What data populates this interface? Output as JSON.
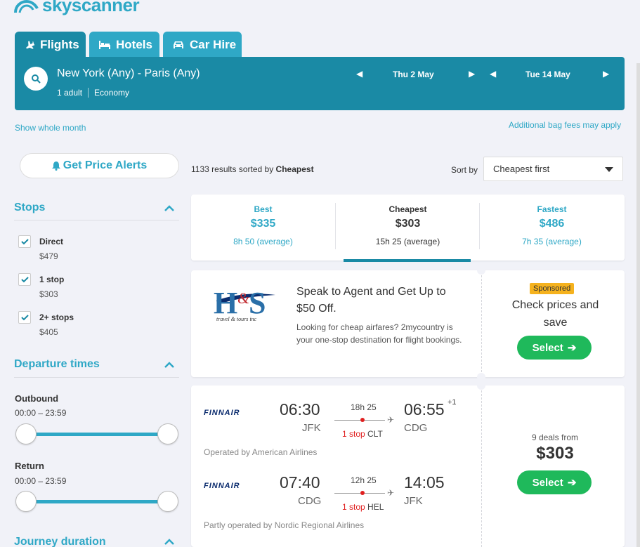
{
  "logo": {
    "text": "skyscanner"
  },
  "tabs": [
    {
      "label": "Flights",
      "icon": "plane-icon",
      "active": true
    },
    {
      "label": "Hotels",
      "icon": "bed-icon",
      "active": false
    },
    {
      "label": "Car Hire",
      "icon": "car-icon",
      "active": false
    }
  ],
  "search": {
    "route": "New York (Any) - Paris (Any)",
    "adults": "1 adult",
    "cabin": "Economy",
    "depart_date": "Thu 2 May",
    "return_date": "Tue 14 May"
  },
  "links": {
    "show_month": "Show whole month",
    "bag_fees": "Additional bag fees may apply"
  },
  "sidebar": {
    "price_alerts": "Get Price Alerts",
    "stops_title": "Stops",
    "stops": [
      {
        "label": "Direct",
        "price": "$479",
        "checked": true
      },
      {
        "label": "1 stop",
        "price": "$303",
        "checked": true
      },
      {
        "label": "2+ stops",
        "price": "$405",
        "checked": true
      }
    ],
    "departure_title": "Departure times",
    "outbound_label": "Outbound",
    "outbound_range": "00:00 – 23:59",
    "return_label": "Return",
    "return_range": "00:00 – 23:59",
    "journey_title": "Journey duration"
  },
  "results": {
    "count": "1133",
    "sorted_by_text": "results sorted by",
    "sorted_by_value": "Cheapest",
    "sort_by_label": "Sort by",
    "sort_selected": "Cheapest first"
  },
  "sort_tabs": [
    {
      "label": "Best",
      "price": "$335",
      "duration": "8h 50 (average)",
      "active": false
    },
    {
      "label": "Cheapest",
      "price": "$303",
      "duration": "15h 25 (average)",
      "active": true
    },
    {
      "label": "Fastest",
      "price": "$486",
      "duration": "7h 35 (average)",
      "active": false
    }
  ],
  "ad": {
    "logo_text": "H&S",
    "logo_sub": "travel & tours inc",
    "title": "Speak to Agent and Get Up to $50 Off.",
    "description": "Looking for cheap airfares? 2mycountry is your one-stop destination for flight bookings.",
    "sponsored": "Sponsored",
    "cta_text": "Check prices and save",
    "select": "Select"
  },
  "flight": {
    "outbound": {
      "airline": "FINNAIR",
      "depart_time": "06:30",
      "depart_code": "JFK",
      "duration": "18h 25",
      "stops_count": "1 stop",
      "stop_airport": "CLT",
      "arrive_time": "06:55",
      "arrive_offset": "+1",
      "arrive_code": "CDG",
      "operated": "Operated by American Airlines"
    },
    "inbound": {
      "airline": "FINNAIR",
      "depart_time": "07:40",
      "depart_code": "CDG",
      "duration": "12h 25",
      "stops_count": "1 stop",
      "stop_airport": "HEL",
      "arrive_time": "14:05",
      "arrive_code": "JFK",
      "operated": "Partly operated by Nordic Regional Airlines"
    },
    "deals": "9 deals from",
    "price": "$303",
    "select": "Select"
  },
  "colors": {
    "brand": "#2fa8c6",
    "brand_dark": "#1a8aa5",
    "select_green": "#1fb95b",
    "sponsored": "#f5b21e",
    "stop_red": "#e02020"
  }
}
